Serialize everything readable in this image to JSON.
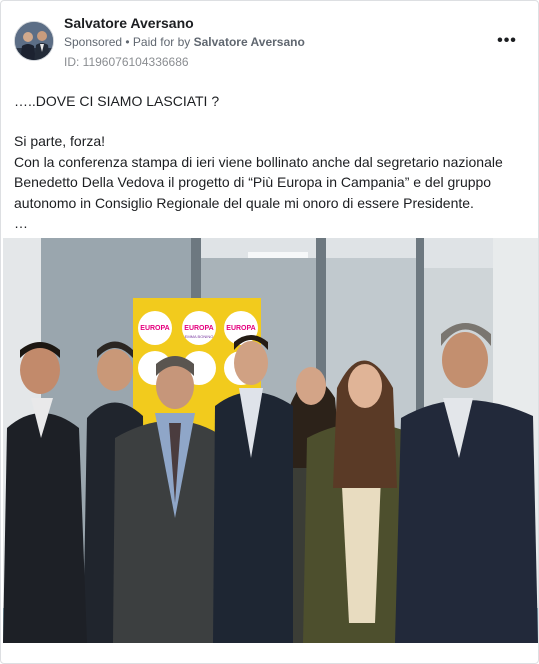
{
  "post": {
    "author": "Salvatore Aversano",
    "sponsored_label": "Sponsored",
    "separator": " • ",
    "paid_for_prefix": "Paid for by ",
    "paid_for_by": "Salvatore Aversano",
    "ad_id": "ID: 1196076104336686",
    "more_icon": "more-horizontal-icon",
    "more_glyph": "•••",
    "text_line1": "…..DOVE CI SIAMO LASCIATI ?",
    "text_body": "Si parte, forza!\nCon la conferenza stampa di ieri viene bollinato anche dal segretario nazionale Benedetto Della Vedova il progetto di “Più Europa in Campania” e del gruppo autonomo in Consiglio Regionale del quale mi onoro di essere Presidente.\n…"
  },
  "banner": {
    "logo_word": "EUROPA",
    "logo_sub": "EMMA BONINO"
  },
  "colors": {
    "banner_yellow": "#f2cb1d",
    "logo_pink": "#e5007e",
    "text_primary": "#1c1e21",
    "text_secondary": "#606770"
  }
}
